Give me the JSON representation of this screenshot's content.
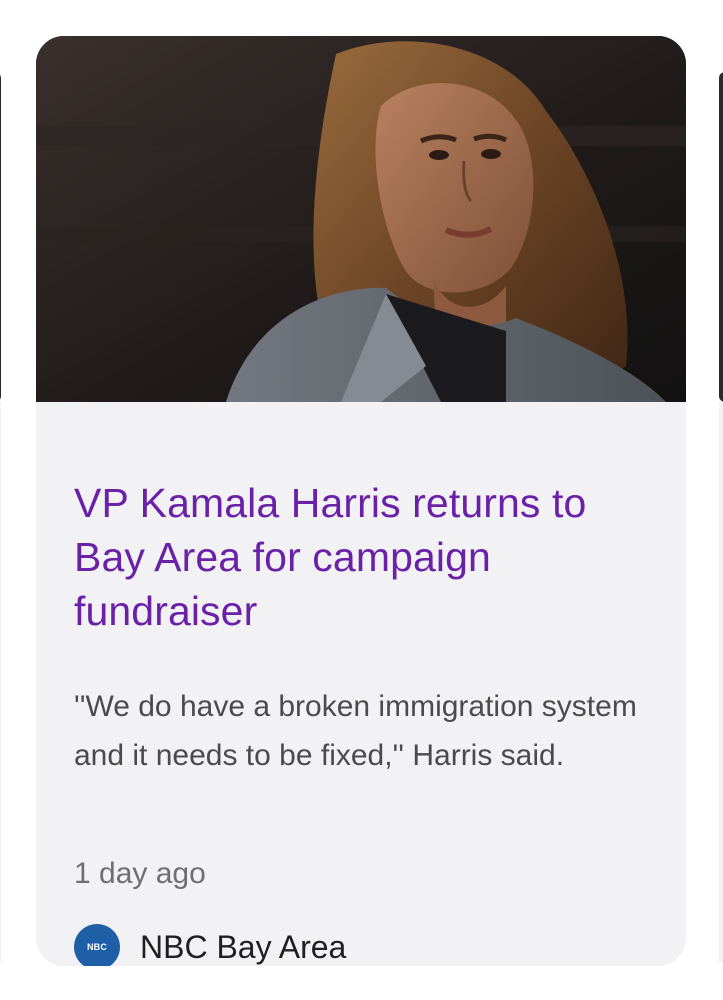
{
  "article": {
    "headline": "VP Kamala Harris returns to Bay Area for campaign fundraiser",
    "snippet": "''We do have a broken immigration system and it needs to be fixed,'' Harris said.",
    "age": "1 day ago",
    "source": {
      "name": "NBC Bay Area",
      "logo_text": "NBC",
      "logo_icon": "nbc-peacock-logo"
    },
    "image": {
      "icon": "news-photo"
    }
  },
  "colors": {
    "headline": "#6a21a8",
    "card_background": "#f2f2f5",
    "snippet": "#4b4b4f",
    "meta": "#6f6f73",
    "source_logo": "#1f5fa8"
  }
}
